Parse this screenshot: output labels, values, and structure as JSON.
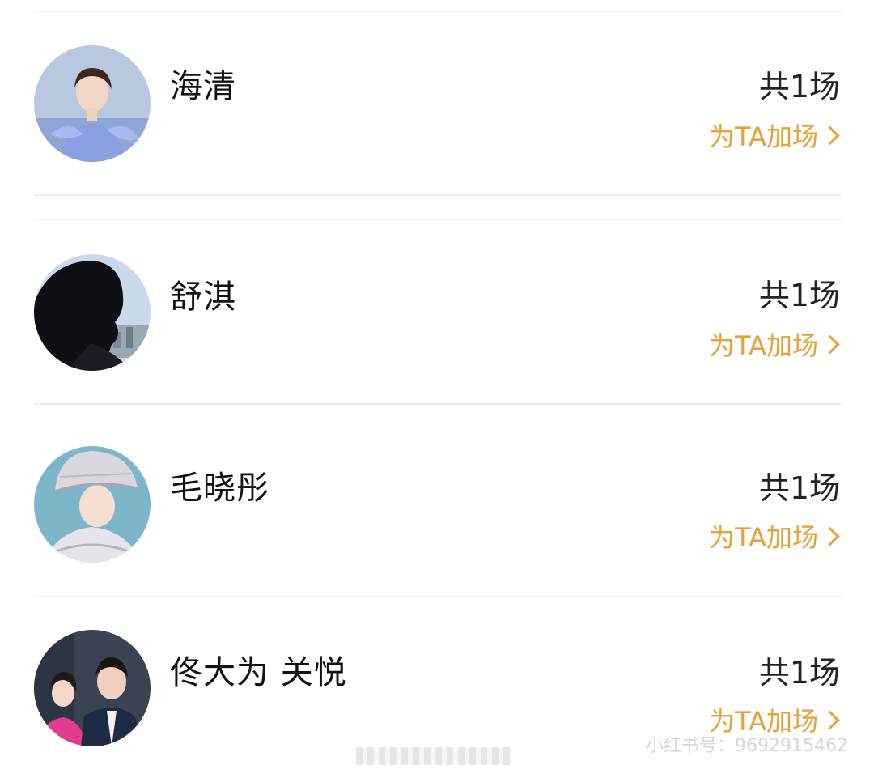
{
  "items": [
    {
      "name": "海清",
      "count": "共1场",
      "action": "为TA加场"
    },
    {
      "name": "舒淇",
      "count": "共1场",
      "action": "为TA加场"
    },
    {
      "name": "毛晓彤",
      "count": "共1场",
      "action": "为TA加场"
    },
    {
      "name": "佟大为 关悦",
      "count": "共1场",
      "action": "为TA加场"
    }
  ],
  "watermark": "小红书号：9692915462",
  "colors": {
    "accent": "#e3a23b",
    "divider": "#efefef",
    "text": "#111111"
  }
}
